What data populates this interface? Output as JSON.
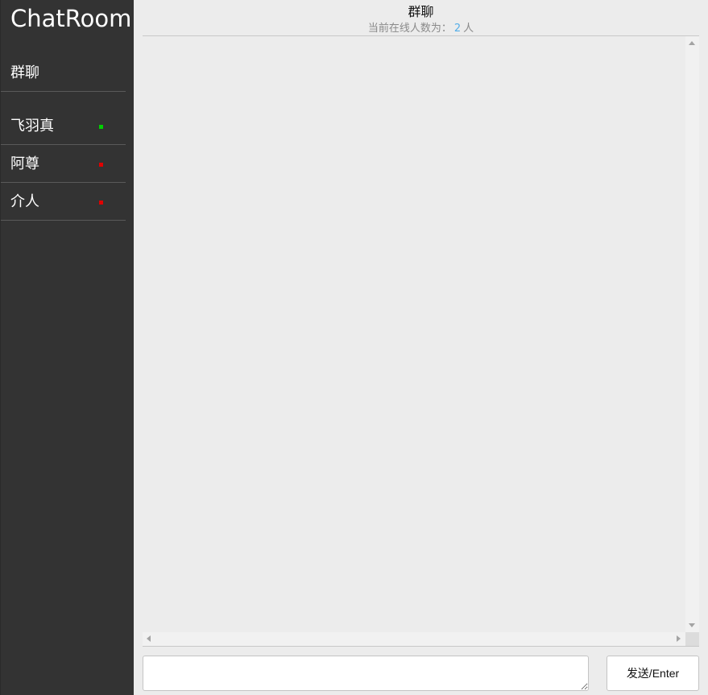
{
  "app": {
    "title": "ChatRoom"
  },
  "sidebar": {
    "group": {
      "label": "群聊"
    },
    "users": [
      {
        "name": "飞羽真",
        "status": "online",
        "status_color": "#00d000"
      },
      {
        "name": "阿尊",
        "status": "offline",
        "status_color": "#e00000"
      },
      {
        "name": "介人",
        "status": "offline",
        "status_color": "#e00000"
      }
    ]
  },
  "header": {
    "title": "群聊",
    "online_prefix": "当前在线人数为：",
    "online_count": "2",
    "online_suffix": "人"
  },
  "composer": {
    "input_value": "",
    "send_label": "发送/Enter"
  },
  "colors": {
    "sidebar_bg": "#333333",
    "main_bg": "#ececec",
    "count_accent": "#55aee8"
  }
}
